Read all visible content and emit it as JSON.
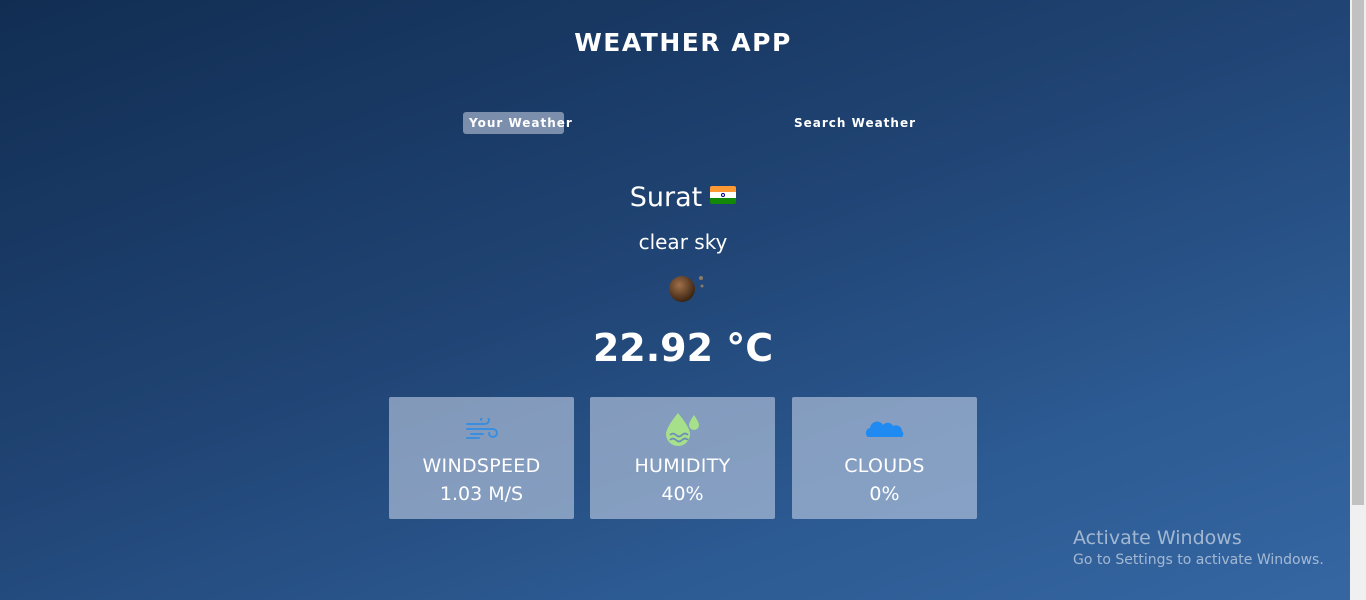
{
  "header": {
    "title": "WEATHER APP"
  },
  "tabs": [
    {
      "label": "Your Weather",
      "active": true
    },
    {
      "label": "Search Weather",
      "active": false
    }
  ],
  "location": {
    "city": "Surat",
    "country_flag": "india-flag-icon"
  },
  "weather": {
    "description": "clear sky",
    "icon": "clear-sky-night-icon",
    "temperature": "22.92 °C"
  },
  "cards": [
    {
      "icon": "wind-icon",
      "label": "WINDSPEED",
      "value": "1.03 M/S"
    },
    {
      "icon": "humidity-icon",
      "label": "HUMIDITY",
      "value": "40%"
    },
    {
      "icon": "cloud-icon",
      "label": "CLOUDS",
      "value": "0%"
    }
  ],
  "watermark": {
    "title": "Activate Windows",
    "subtitle": "Go to Settings to activate Windows."
  },
  "colors": {
    "background_top": "#112d52",
    "background_bottom": "#3667a3",
    "card": "#8fa3c4",
    "wind_icon": "#3a8ee0",
    "humidity_icon": "#a6e08a",
    "cloud_icon": "#1f8bf2"
  }
}
